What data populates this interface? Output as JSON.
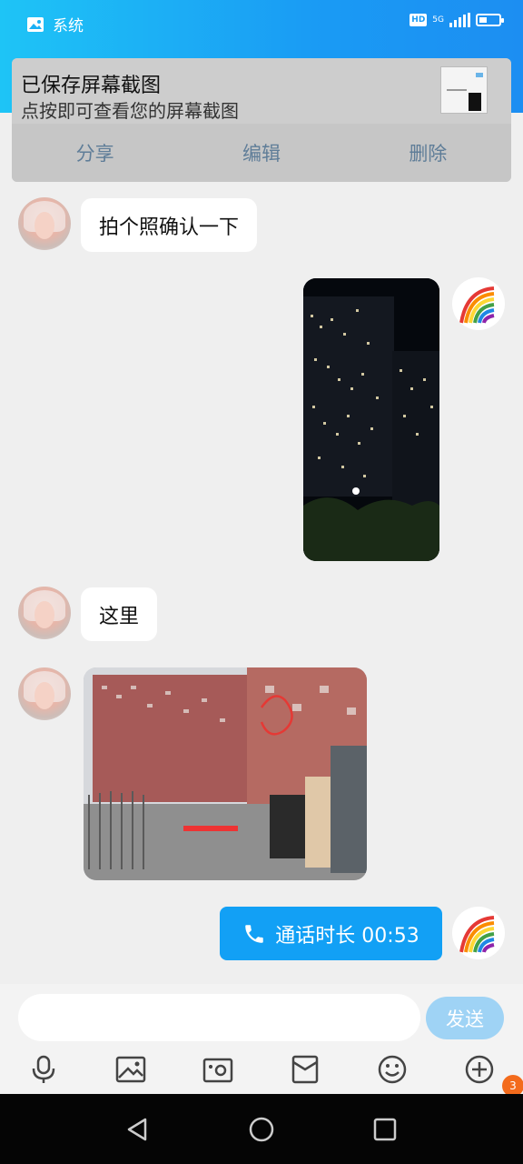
{
  "status_bar": {
    "app_label": "系统",
    "hd": "HD",
    "network": "5G",
    "battery_level": 0.35
  },
  "notification": {
    "title": "已保存屏幕截图",
    "subtitle": "点按即可查看您的屏幕截图",
    "actions": {
      "share": "分享",
      "edit": "编辑",
      "delete": "删除"
    }
  },
  "messages": [
    {
      "side": "left",
      "type": "text",
      "text": "拍个照确认一下"
    },
    {
      "side": "right",
      "type": "image",
      "description_icon": "night-building-photo"
    },
    {
      "side": "left",
      "type": "text",
      "text": "这里"
    },
    {
      "side": "left",
      "type": "image",
      "description_icon": "building-gate-photo"
    },
    {
      "side": "right",
      "type": "call",
      "text": "通话时长 00:53"
    }
  ],
  "composer": {
    "placeholder": "",
    "send_label": "发送"
  },
  "toolbar": {
    "icons": [
      "microphone-icon",
      "image-icon",
      "camera-icon",
      "red-packet-icon",
      "emoji-icon",
      "plus-icon"
    ],
    "badge_count": "3"
  },
  "colors": {
    "header_gradient_start": "#1ec4f6",
    "header_gradient_end": "#1c8ef2",
    "call_bubble": "#12a0f5",
    "send_button": "#9fd3f5",
    "badge": "#f36b1c"
  }
}
